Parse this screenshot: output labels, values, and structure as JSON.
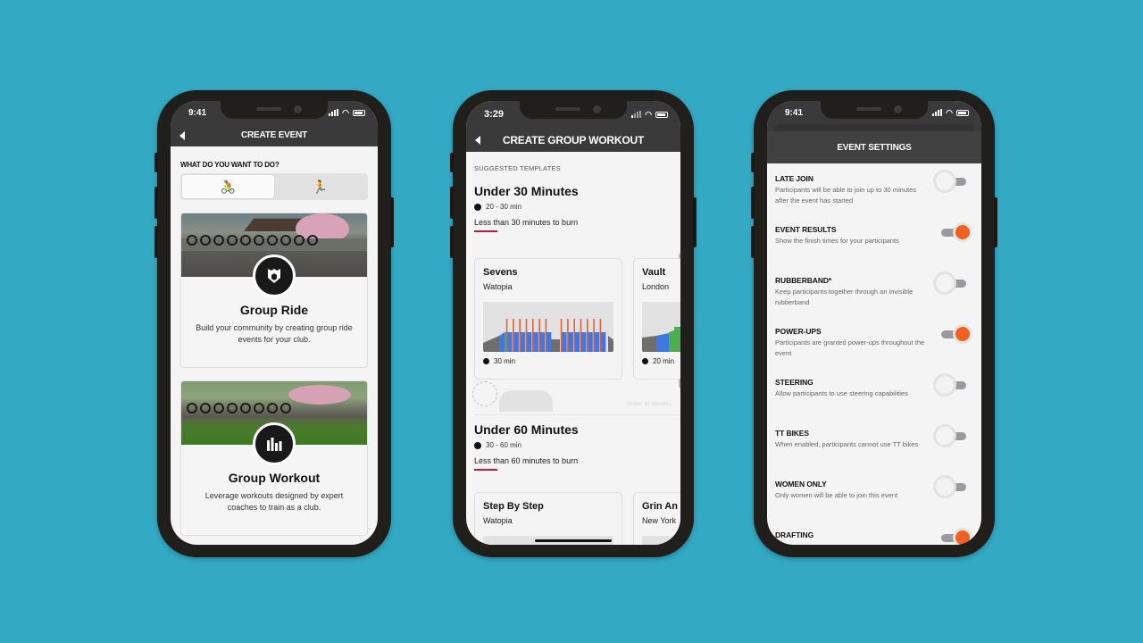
{
  "background_color": "#34a9c4",
  "accent_color": "#f0601f",
  "underline_color": "#b7194b",
  "phone1": {
    "status_time": "9:41",
    "nav_title": "CREATE EVENT",
    "question": "WHAT DO YOU WANT TO DO?",
    "segments": [
      {
        "icon": "cycling-icon",
        "glyph": "🚴",
        "active": true
      },
      {
        "icon": "running-icon",
        "glyph": "🏃",
        "active": false
      }
    ],
    "cards": [
      {
        "title": "Group Ride",
        "description": "Build your community by creating group ride events for your club.",
        "icon": "shield-icon"
      },
      {
        "title": "Group Workout",
        "description": "Leverage workouts designed by expert coaches to train as a club.",
        "icon": "bar-chart-icon"
      }
    ]
  },
  "phone2": {
    "status_time": "3:29",
    "nav_title": "CREATE GROUP WORKOUT",
    "section_label": "SUGGESTED TEMPLATES",
    "sections": [
      {
        "title": "Under 30 Minutes",
        "duration_range": "20 - 30 min",
        "description": "Less than 30 minutes to burn",
        "templates": [
          {
            "name": "Sevens",
            "world": "Watopia",
            "duration": "30 min"
          },
          {
            "name": "Vault",
            "world": "London",
            "duration": "20 min"
          }
        ],
        "watermark": "Under 30 Minutes"
      },
      {
        "title": "Under 60 Minutes",
        "duration_range": "30 - 60 min",
        "description": "Less than 60 minutes to burn",
        "templates": [
          {
            "name": "Step By Step",
            "world": "Watopia",
            "duration": ""
          },
          {
            "name": "Grin An",
            "world": "New York",
            "duration": ""
          }
        ]
      }
    ]
  },
  "phone3": {
    "status_time": "9:41",
    "nav_title": "EVENT SETTINGS",
    "settings": [
      {
        "title": "LATE JOIN",
        "description": "Participants will be able to join up to 30 minutes after the event has started",
        "enabled": false
      },
      {
        "title": "EVENT RESULTS",
        "description": "Show the finish times for your participants",
        "enabled": true
      },
      {
        "title": "RUBBERBAND*",
        "description": "Keep participants together through an invisible rubberband",
        "enabled": false
      },
      {
        "title": "POWER-UPS",
        "description": "Participants are granted power-ups throughout the event",
        "enabled": true
      },
      {
        "title": "STEERING",
        "description": "Allow participants to use steering capabilities",
        "enabled": false
      },
      {
        "title": "TT BIKES",
        "description": "When enabled, participants cannot use TT bikes",
        "enabled": false
      },
      {
        "title": "WOMEN ONLY",
        "description": "Only women will be able to join this event",
        "enabled": false
      },
      {
        "title": "DRAFTING",
        "description": "",
        "enabled": true
      }
    ]
  }
}
